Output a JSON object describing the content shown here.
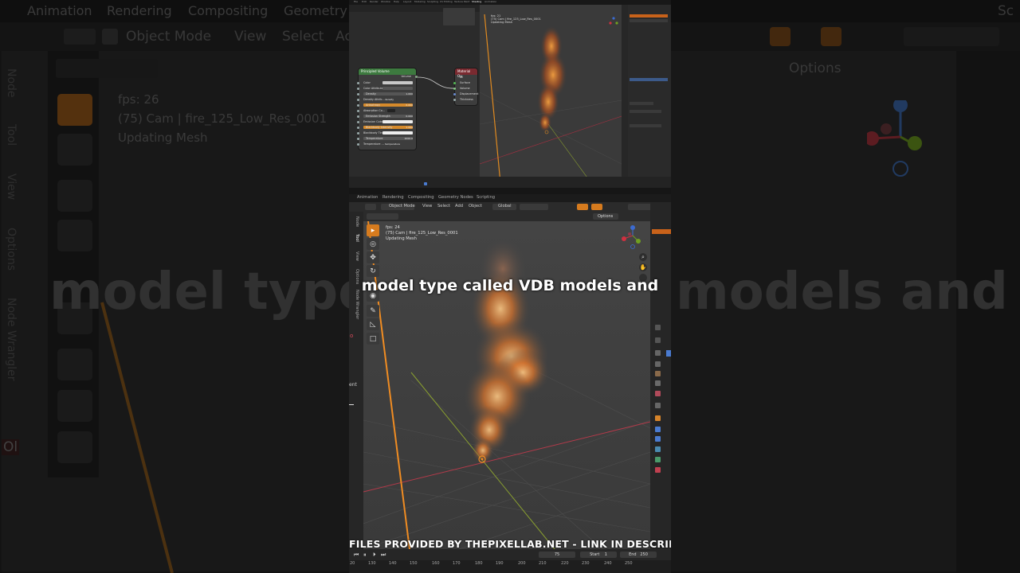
{
  "background": {
    "tabs": [
      "Animation",
      "Rendering",
      "Compositing",
      "Geometry N"
    ],
    "header": {
      "mode": "Object Mode",
      "menus": [
        "View",
        "Select",
        "Ac"
      ],
      "options": "Options",
      "right_text": "Sc"
    },
    "side_tabs": [
      "Node",
      "Tool",
      "View",
      "Options",
      "Node Wrangler"
    ],
    "overlay": {
      "fps": "fps: 26",
      "cam": "(75) Cam | fire_125_Low_Res_0001",
      "status": "Updating Mesh"
    },
    "caption_left": "model type",
    "caption_right": "models and",
    "left_edge": "Ol"
  },
  "thumbnail": {
    "menu": [
      "File",
      "Edit",
      "Render",
      "Window",
      "Help",
      "Layout",
      "Modeling",
      "Sculpting",
      "UV Editing",
      "Texture Paint",
      "Shading",
      "Animation"
    ],
    "node_volume": {
      "title": "Principled Volume",
      "output": "Volume",
      "rows": [
        {
          "label": "Color",
          "value": ""
        },
        {
          "label": "Color Attribute",
          "value": ""
        },
        {
          "label": "Density",
          "value": "1.000"
        },
        {
          "label": "Density Attrib...",
          "value": "density"
        },
        {
          "label": "Anisotropy",
          "value": "0.000"
        },
        {
          "label": "Absorption Co...",
          "value": ""
        },
        {
          "label": "Emission Strength",
          "value": "0.000"
        },
        {
          "label": "Emission Color",
          "value": ""
        },
        {
          "label": "Blackbody Intensity",
          "value": "1.000"
        },
        {
          "label": "Blackbody Tint",
          "value": ""
        },
        {
          "label": "Temperature",
          "value": "1000.0"
        },
        {
          "label": "Temperature ...",
          "value": "temperature"
        }
      ]
    },
    "node_output": {
      "title": "Material Ou",
      "selector": "All",
      "inputs": [
        "Surface",
        "Volume",
        "Displacement",
        "Thickness"
      ]
    },
    "overlay": {
      "fps": "fps: 21",
      "cam": "(75) Cam | fire_125_Low_Res_0001",
      "status": "Updating Mesh"
    }
  },
  "main": {
    "workspace_tabs": [
      "Animation",
      "Rendering",
      "Compositing",
      "Geometry Nodes",
      "Scripting"
    ],
    "header": {
      "mode": "Object Mode",
      "menus": [
        "View",
        "Select",
        "Add",
        "Object"
      ],
      "transform": "Global",
      "options": "Options"
    },
    "side_tabs": [
      "Node",
      "Tool",
      "View",
      "Options",
      "Node Wrangler"
    ],
    "overlay": {
      "fps": "fps: 24",
      "cam": "(75) Cam | fire_125_Low_Res_0001",
      "status": "Updating Mesh"
    },
    "caption": "model type called VDB models and",
    "banner": "FILES PROVIDED BY THEPIXELLAB.NET - LINK IN DESCRIPTION",
    "timeline": {
      "current_frame": "75",
      "start_label": "Start",
      "start_value": "1",
      "end_label": "End",
      "end_value": "250",
      "ticks": [
        "20",
        "130",
        "140",
        "150",
        "160",
        "170",
        "180",
        "190",
        "200",
        "210",
        "220",
        "230",
        "240",
        "250"
      ]
    },
    "left_edge": [
      "o",
      "ent"
    ]
  },
  "colors": {
    "accent_orange": "#d67b1e",
    "fire": "#e0702a",
    "panel": "#2b2b2b"
  }
}
